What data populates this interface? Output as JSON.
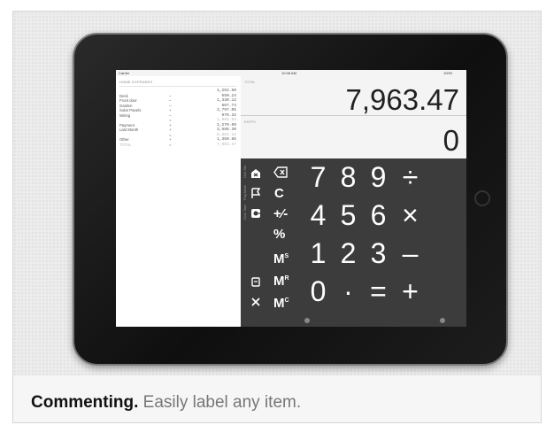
{
  "caption": {
    "lead": "Commenting.",
    "rest": " Easily label any item."
  },
  "status_bar": {
    "carrier": "Carrier",
    "time": "10:38 AM",
    "battery": "100%"
  },
  "notes": {
    "heading": "HOME EXPENSES",
    "rows": [
      {
        "label": "",
        "op": "",
        "value": "1,252.50",
        "faint": false
      },
      {
        "label": "Deck",
        "op": "–",
        "value": "550.24",
        "faint": false
      },
      {
        "label": "Front door",
        "op": "–",
        "value": "1,330.12",
        "faint": false
      },
      {
        "label": "Garden",
        "op": "–",
        "value": "667.74",
        "faint": false
      },
      {
        "label": "Solar Panels",
        "op": "+",
        "value": "2,797.05",
        "faint": false
      },
      {
        "label": "Wiring",
        "op": "–",
        "value": "978.32",
        "faint": false
      },
      {
        "label": "",
        "op": "=",
        "value": "1,993.53",
        "faint": true
      },
      {
        "label": "Payment",
        "op": "+",
        "value": "1,270.89",
        "faint": false
      },
      {
        "label": "Last Month",
        "op": "+",
        "value": "3,588.30",
        "faint": false
      },
      {
        "label": "",
        "op": "=",
        "value": "6,852.12",
        "faint": true
      },
      {
        "label": "Other",
        "op": "+",
        "value": "1,350.85",
        "faint": false
      },
      {
        "label": "TOTAL",
        "op": "=",
        "value": "7,963.47",
        "faint": true
      }
    ]
  },
  "display": {
    "total_label": "TOTAL",
    "total": "7,963.47",
    "entry_label": "ENTRY",
    "entry": "0"
  },
  "tools": {
    "left_labels": [
      "New Tab",
      "Flag Mode",
      "Clear Tape"
    ]
  },
  "functions": {
    "backspace": "⌫",
    "clear": "C",
    "sign": "+⁄-",
    "percent": "%",
    "ms": "M",
    "ms_sup": "S",
    "mr": "M",
    "mr_sup": "R",
    "mc": "M",
    "mc_sup": "C"
  },
  "keypad": {
    "row1": [
      "7",
      "8",
      "9",
      "÷"
    ],
    "row2": [
      "4",
      "5",
      "6",
      "×"
    ],
    "row3": [
      "1",
      "2",
      "3",
      "–"
    ],
    "row4": [
      "0",
      "·",
      "=",
      "+"
    ]
  }
}
